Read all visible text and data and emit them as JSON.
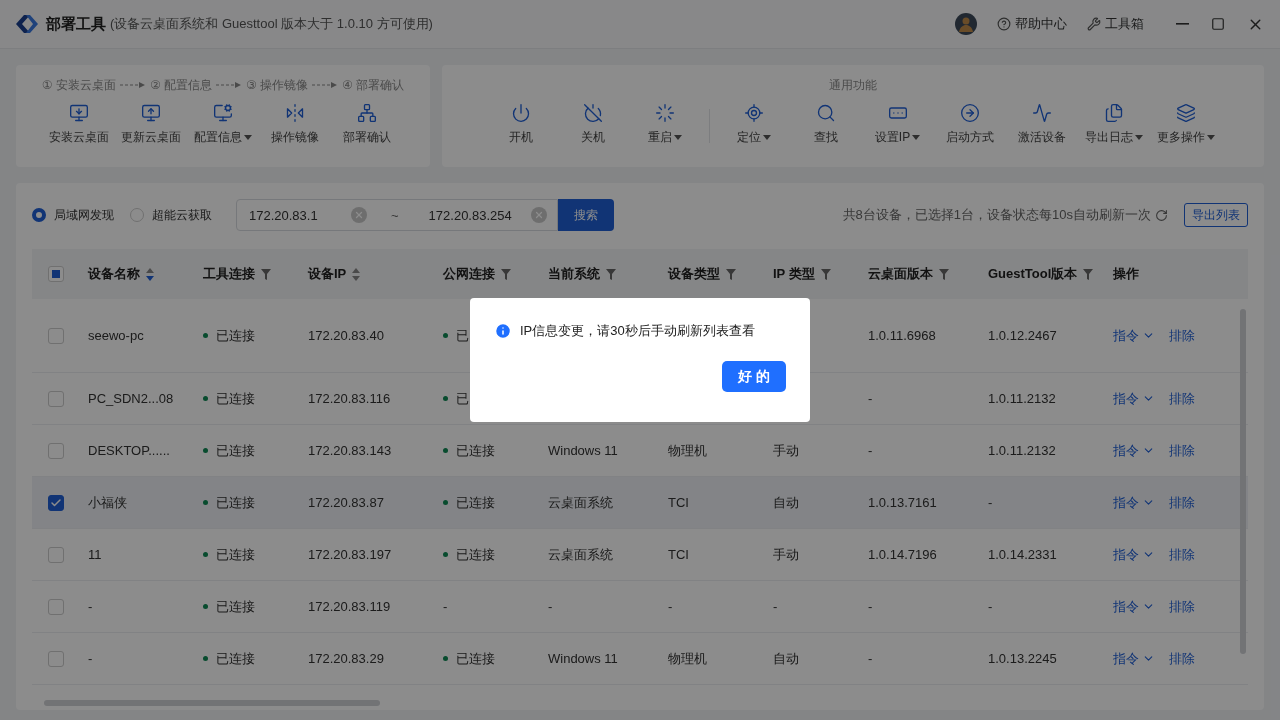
{
  "title_bar": {
    "app_name": "部署工具",
    "subtitle": "(设备云桌面系统和 Guesttool 版本大于 1.0.10 方可使用)",
    "links": [
      {
        "label": "帮助中心"
      },
      {
        "label": "工具箱"
      }
    ]
  },
  "deploy_panel": {
    "steps": [
      "① 安装云桌面",
      "② 配置信息",
      "③ 操作镜像",
      "④ 部署确认"
    ],
    "tools": [
      {
        "label": "安装云桌面",
        "has_menu": false
      },
      {
        "label": "更新云桌面",
        "has_menu": false
      },
      {
        "label": "配置信息",
        "has_menu": true
      },
      {
        "label": "操作镜像",
        "has_menu": false
      },
      {
        "label": "部署确认",
        "has_menu": false
      }
    ]
  },
  "general_panel": {
    "title": "通用功能",
    "groups": [
      [
        {
          "label": "开机",
          "has_menu": false
        },
        {
          "label": "关机",
          "has_menu": false
        },
        {
          "label": "重启",
          "has_menu": true
        }
      ],
      [
        {
          "label": "定位",
          "has_menu": true
        },
        {
          "label": "查找",
          "has_menu": false
        },
        {
          "label": "设置IP",
          "has_menu": true
        },
        {
          "label": "启动方式",
          "has_menu": false
        },
        {
          "label": "激活设备",
          "has_menu": false
        },
        {
          "label": "导出日志",
          "has_menu": true
        },
        {
          "label": "更多操作",
          "has_menu": true
        }
      ]
    ]
  },
  "search": {
    "modes": [
      {
        "label": "局域网发现",
        "selected": true
      },
      {
        "label": "超能云获取",
        "selected": false
      }
    ],
    "range_start": "172.20.83.1",
    "range_separator": "~",
    "range_end": "172.20.83.254",
    "button": "搜索",
    "summary": "共8台设备，已选择1台，设备状态每10s自动刷新一次",
    "export_button": "导出列表"
  },
  "table": {
    "select_all_partial": true,
    "columns": [
      {
        "label": "设备名称",
        "kind": "sort",
        "sort_descending": true
      },
      {
        "label": "工具连接",
        "kind": "filter"
      },
      {
        "label": "设备IP",
        "kind": "sort",
        "sort_descending": false
      },
      {
        "label": "公网连接",
        "kind": "filter"
      },
      {
        "label": "当前系统",
        "kind": "filter"
      },
      {
        "label": "设备类型",
        "kind": "filter"
      },
      {
        "label": "IP 类型",
        "kind": "filter"
      },
      {
        "label": "云桌面版本",
        "kind": "filter"
      },
      {
        "label": "GuestTool版本",
        "kind": "filter"
      },
      {
        "label": "操作",
        "kind": "plain"
      }
    ],
    "rows": [
      {
        "selected": false,
        "name": "seewo-pc",
        "tool": {
          "text": "已连接",
          "connected": true
        },
        "ip": "172.20.83.40",
        "public": {
          "text": "已",
          "connected": true
        },
        "cloud_version": "1.0.11.6968",
        "guest_version": "1.0.12.2467",
        "command": "指令",
        "remove": "排除"
      },
      {
        "selected": false,
        "name": "PC_SDN2...08",
        "tool": {
          "text": "已连接",
          "connected": true
        },
        "ip": "172.20.83.116",
        "public": {
          "text": "已",
          "connected": true
        },
        "cloud_version": "-",
        "guest_version": "1.0.11.2132",
        "command": "指令",
        "remove": "排除"
      },
      {
        "selected": false,
        "name": "DESKTOP......",
        "tool": {
          "text": "已连接",
          "connected": true
        },
        "ip": "172.20.83.143",
        "public": {
          "text": "已连接",
          "connected": true
        },
        "system": "Windows 11",
        "type": "物理机",
        "ip_type": "手动",
        "cloud_version": "-",
        "guest_version": "1.0.11.2132",
        "command": "指令",
        "remove": "排除"
      },
      {
        "selected": true,
        "name": "小福侠",
        "tool": {
          "text": "已连接",
          "connected": true
        },
        "ip": "172.20.83.87",
        "public": {
          "text": "已连接",
          "connected": true
        },
        "system": "云桌面系统",
        "type": "TCI",
        "ip_type": "自动",
        "cloud_version": "1.0.13.7161",
        "guest_version": "-",
        "command": "指令",
        "remove": "排除"
      },
      {
        "selected": false,
        "name": "11",
        "tool": {
          "text": "已连接",
          "connected": true
        },
        "ip": "172.20.83.197",
        "public": {
          "text": "已连接",
          "connected": true
        },
        "system": "云桌面系统",
        "type": "TCI",
        "ip_type": "手动",
        "cloud_version": "1.0.14.7196",
        "guest_version": "1.0.14.2331",
        "command": "指令",
        "remove": "排除"
      },
      {
        "selected": false,
        "name": "-",
        "tool": {
          "text": "已连接",
          "connected": true
        },
        "ip": "172.20.83.119",
        "public": {
          "text": "-",
          "connected": false
        },
        "system": "-",
        "type": "-",
        "ip_type": "-",
        "cloud_version": "-",
        "guest_version": "-",
        "command": "指令",
        "remove": "排除"
      },
      {
        "selected": false,
        "name": "-",
        "tool": {
          "text": "已连接",
          "connected": true
        },
        "ip": "172.20.83.29",
        "public": {
          "text": "已连接",
          "connected": true
        },
        "system": "Windows 11",
        "type": "物理机",
        "ip_type": "自动",
        "cloud_version": "-",
        "guest_version": "1.0.13.2245",
        "command": "指令",
        "remove": "排除"
      }
    ]
  },
  "dialog": {
    "message": "IP信息变更，请30秒后手动刷新列表查看",
    "button": "好 的"
  }
}
